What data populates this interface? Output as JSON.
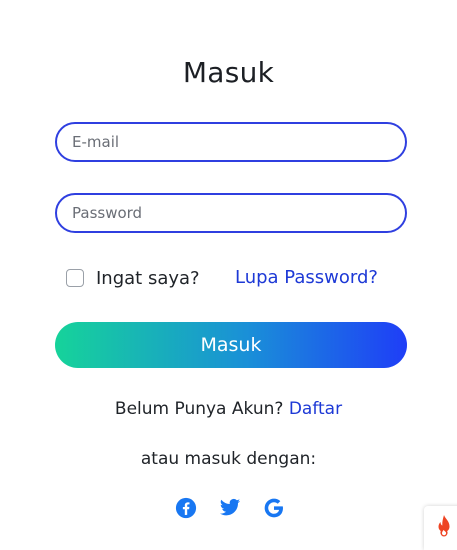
{
  "login": {
    "title": "Masuk",
    "email_placeholder": "E-mail",
    "password_placeholder": "Password",
    "remember_label": "Ingat saya?",
    "remember_checked": false,
    "forgot_link": "Lupa Password?",
    "submit_label": "Masuk"
  },
  "register": {
    "prompt": "Belum Punya Akun?",
    "link": "Daftar"
  },
  "social": {
    "prompt": "atau masuk dengan:",
    "icons": [
      "facebook-icon",
      "twitter-icon",
      "google-icon"
    ]
  },
  "badge": {
    "icon": "flame-icon"
  },
  "colors": {
    "accent": "#1d39d6",
    "input_border": "#2f3fe0",
    "button_gradient_start": "#16d39a",
    "button_gradient_end": "#1f3ef7",
    "social_icon": "#1877f2",
    "flame": "#ee4423"
  }
}
